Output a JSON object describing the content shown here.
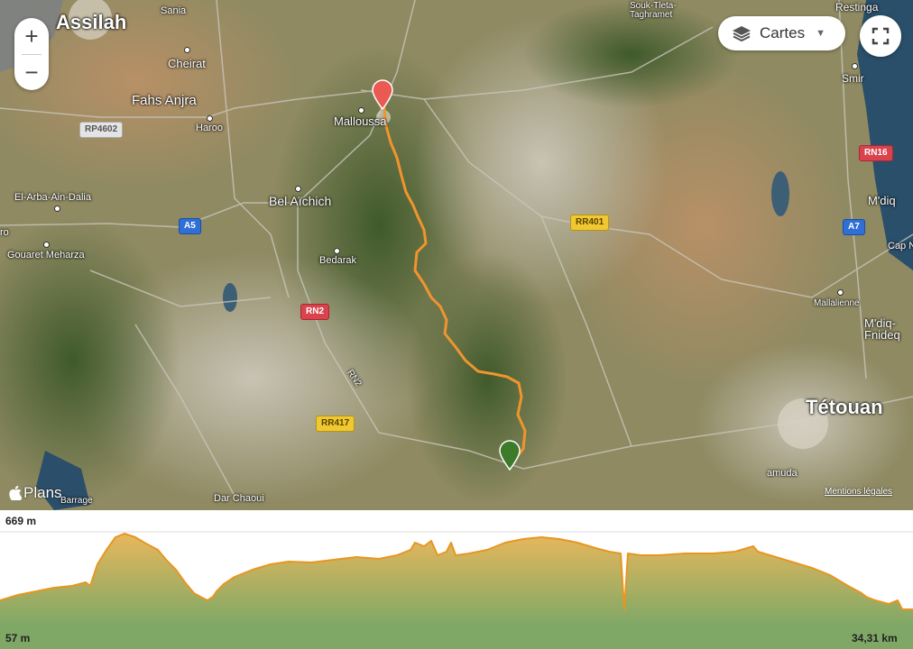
{
  "map": {
    "labels_big": [
      "Assilah",
      "Tétouan"
    ],
    "places": [
      "Sania",
      "Cheirat",
      "Fahs Anjra",
      "Haroo",
      "Malloussa",
      "El-Arba-Ain-Dalia",
      "Bel Aïchich",
      "Gouaret Meharza",
      "Bedarak",
      "Dar Chaoui",
      "Barrage",
      "Souk-Tleta-Taghramet",
      "Restinga",
      "Smir",
      "M'diq",
      "Cap N",
      "Mallalienne",
      "M'diq-Fnideq",
      "amuda",
      "ro",
      "Assilah"
    ],
    "roads": [
      "RP4602",
      "A5",
      "RN2",
      "RR417",
      "RR401",
      "RN16",
      "A7"
    ],
    "road_rn2_diagonal": "RN2",
    "route_color": "#f0952d",
    "start_marker_color": "#ea5a52",
    "end_marker_color": "#3d7a2a"
  },
  "controls": {
    "zoom_in": "+",
    "zoom_out": "−",
    "layers_label": "Cartes",
    "layers_icon": "layers-icon",
    "fullscreen_icon": "fullscreen-icon",
    "attribution": "Plans",
    "legal": "Mentions légales"
  },
  "profile": {
    "max_elevation": "669 m",
    "min_elevation": "57 m",
    "distance": "34,31 km",
    "fill_top_color": "#e8b75c",
    "fill_bottom_color": "#7fa866",
    "line_color": "#e79620"
  }
}
